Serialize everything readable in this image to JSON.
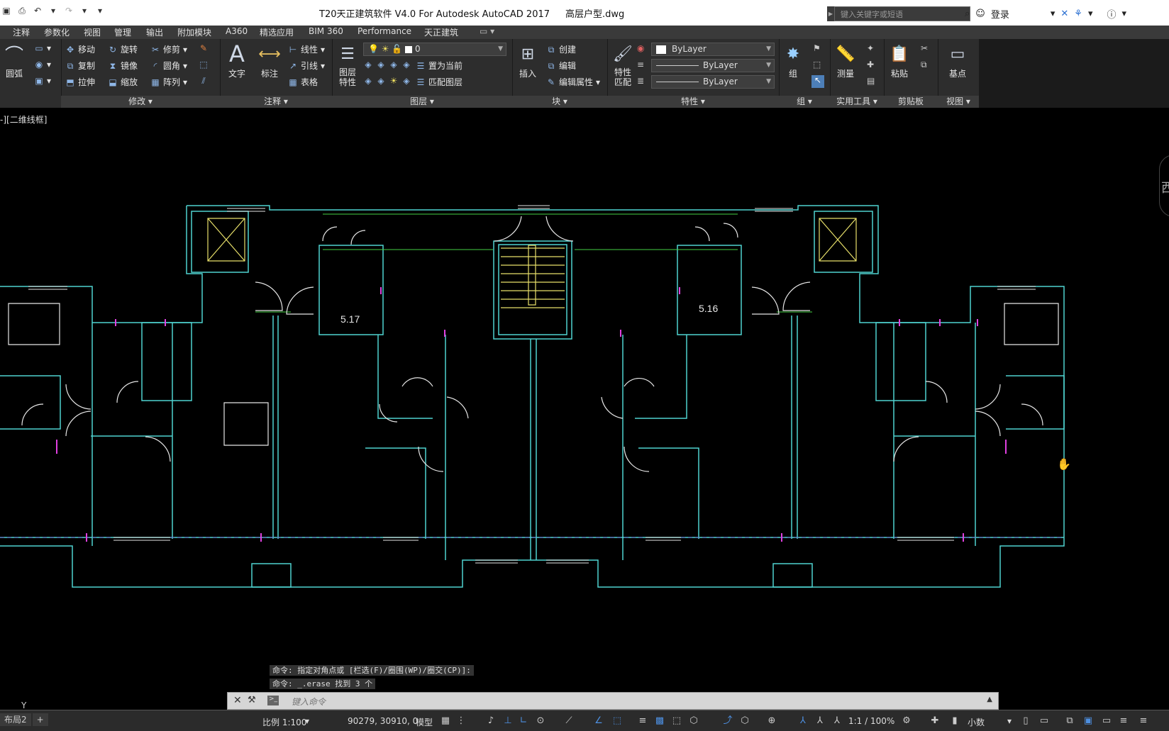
{
  "app": {
    "title": "T20天正建筑软件 V4.0 For Autodesk AutoCAD 2017",
    "filename": "高层户型.dwg",
    "search_placeholder": "键入关键字或短语",
    "login_label": "登录"
  },
  "menu": [
    "注释",
    "参数化",
    "视图",
    "管理",
    "输出",
    "附加模块",
    "A360",
    "精选应用",
    "BIM 360",
    "Performance",
    "天正建筑"
  ],
  "ribbon": {
    "draw": {
      "arc_label": "圆弧"
    },
    "modify": {
      "title": "修改",
      "move": "移动",
      "rotate": "旋转",
      "trim": "修剪",
      "copy": "复制",
      "mirror": "镜像",
      "fillet": "圆角",
      "stretch": "拉伸",
      "scale": "缩放",
      "array": "阵列"
    },
    "annotation": {
      "title": "注释",
      "text": "文字",
      "dimension": "标注",
      "linear": "线性",
      "leader": "引线",
      "table": "表格"
    },
    "layers": {
      "title": "图层",
      "layer_props": "图层\n特性",
      "layer_name": "0",
      "set_current": "置为当前",
      "match_layer": "匹配图层"
    },
    "block": {
      "title": "块",
      "insert": "插入",
      "create": "创建",
      "edit": "编辑",
      "edit_attr": "编辑属性"
    },
    "properties": {
      "title": "特性",
      "match": "特性\n匹配",
      "color": "ByLayer",
      "linetype": "ByLayer",
      "lineweight": "ByLayer"
    },
    "group": {
      "title": "组",
      "group": "组"
    },
    "utilities": {
      "title": "实用工具",
      "measure": "测量"
    },
    "clipboard": {
      "title": "剪贴板",
      "paste": "粘贴"
    },
    "view": {
      "title": "视图",
      "base": "基点"
    }
  },
  "viewport": {
    "label": "-][二维线框]",
    "compass_label": "西",
    "room_labels": [
      "5.17",
      "5.16"
    ]
  },
  "command": {
    "history": [
      "命令: 指定对角点或 [栏选(F)/圈围(WP)/圈交(CP)]:",
      "命令: _.erase 找到 3 个"
    ],
    "placeholder": "键入命令"
  },
  "status": {
    "layout_tab": "布局2",
    "scale": "比例 1:100",
    "coords": "90279, 30910, 0",
    "model": "模型",
    "annotation_scale": "1:1 / 100%",
    "units": "小数"
  },
  "colors": {
    "wall": "#4fd3d0",
    "door": "#e6e6e6",
    "window_mark": "#e040e0",
    "green_line": "#44d044",
    "yellow": "#e8e06a"
  }
}
